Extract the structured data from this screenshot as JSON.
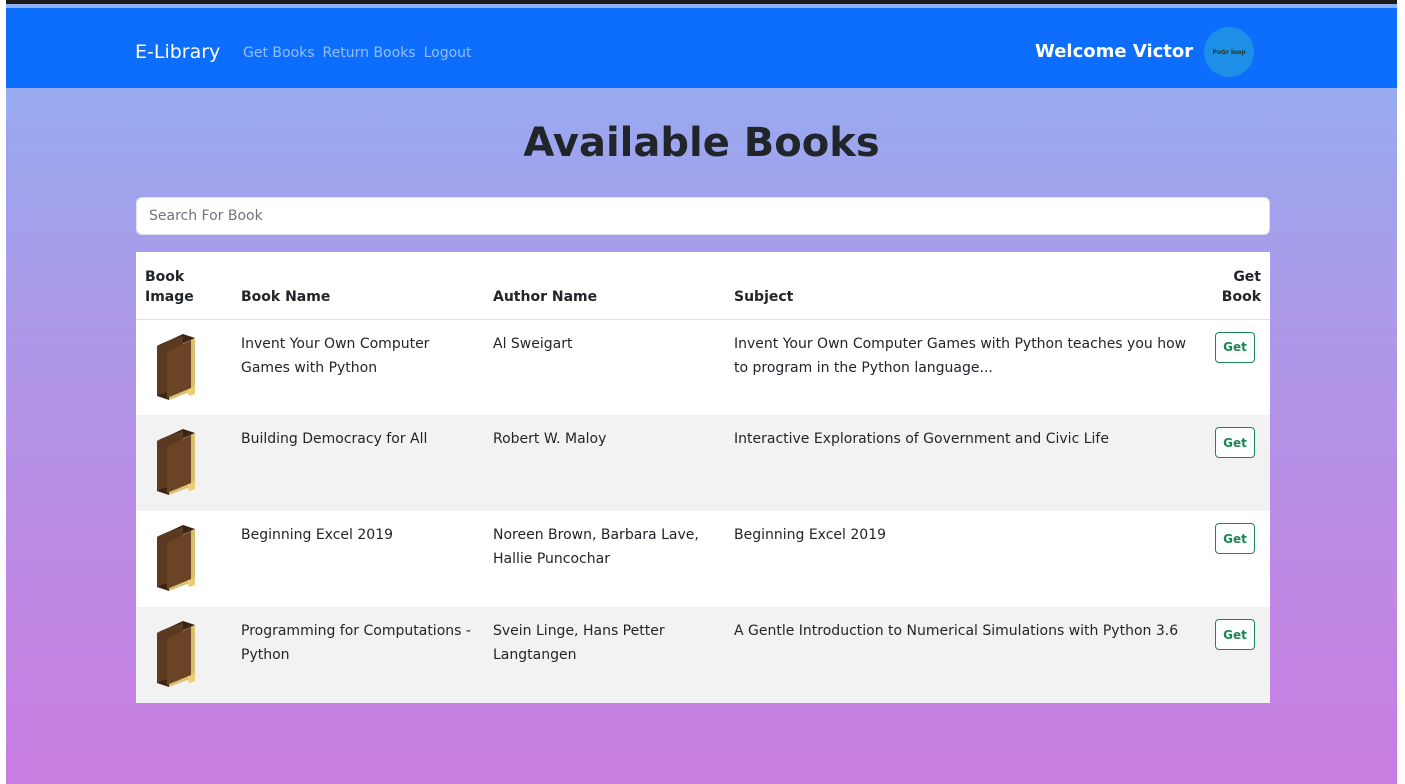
{
  "navbar": {
    "brand": "E-Library",
    "links": [
      "Get Books",
      "Return Books",
      "Logout"
    ],
    "welcome": "Welcome Victor",
    "avatar_text": "PoGr loop"
  },
  "page": {
    "title": "Available Books",
    "search_placeholder": "Search For Book"
  },
  "table": {
    "headers": {
      "image": "Book Image",
      "name": "Book Name",
      "author": "Author Name",
      "subject": "Subject",
      "get": "Get Book"
    },
    "rows": [
      {
        "name": "Invent Your Own Computer Games with Python",
        "author": "Al Sweigart",
        "subject": "Invent Your Own Computer Games with Python teaches you how to program in the Python language...",
        "action": "Get"
      },
      {
        "name": "Building Democracy for All",
        "author": "Robert W. Maloy",
        "subject": "Interactive Explorations of Government and Civic Life",
        "action": "Get"
      },
      {
        "name": "Beginning Excel 2019",
        "author": "Noreen Brown, Barbara Lave, Hallie Puncochar",
        "subject": "Beginning Excel 2019",
        "action": "Get"
      },
      {
        "name": "Programming for Computations - Python",
        "author": "Svein Linge, Hans Petter Langtangen",
        "subject": "A Gentle Introduction to Numerical Simulations with Python 3.6",
        "action": "Get"
      }
    ]
  },
  "colors": {
    "navbar": "#0d6efd",
    "accent_green": "#198754",
    "book_brown": "#5c3a21"
  }
}
